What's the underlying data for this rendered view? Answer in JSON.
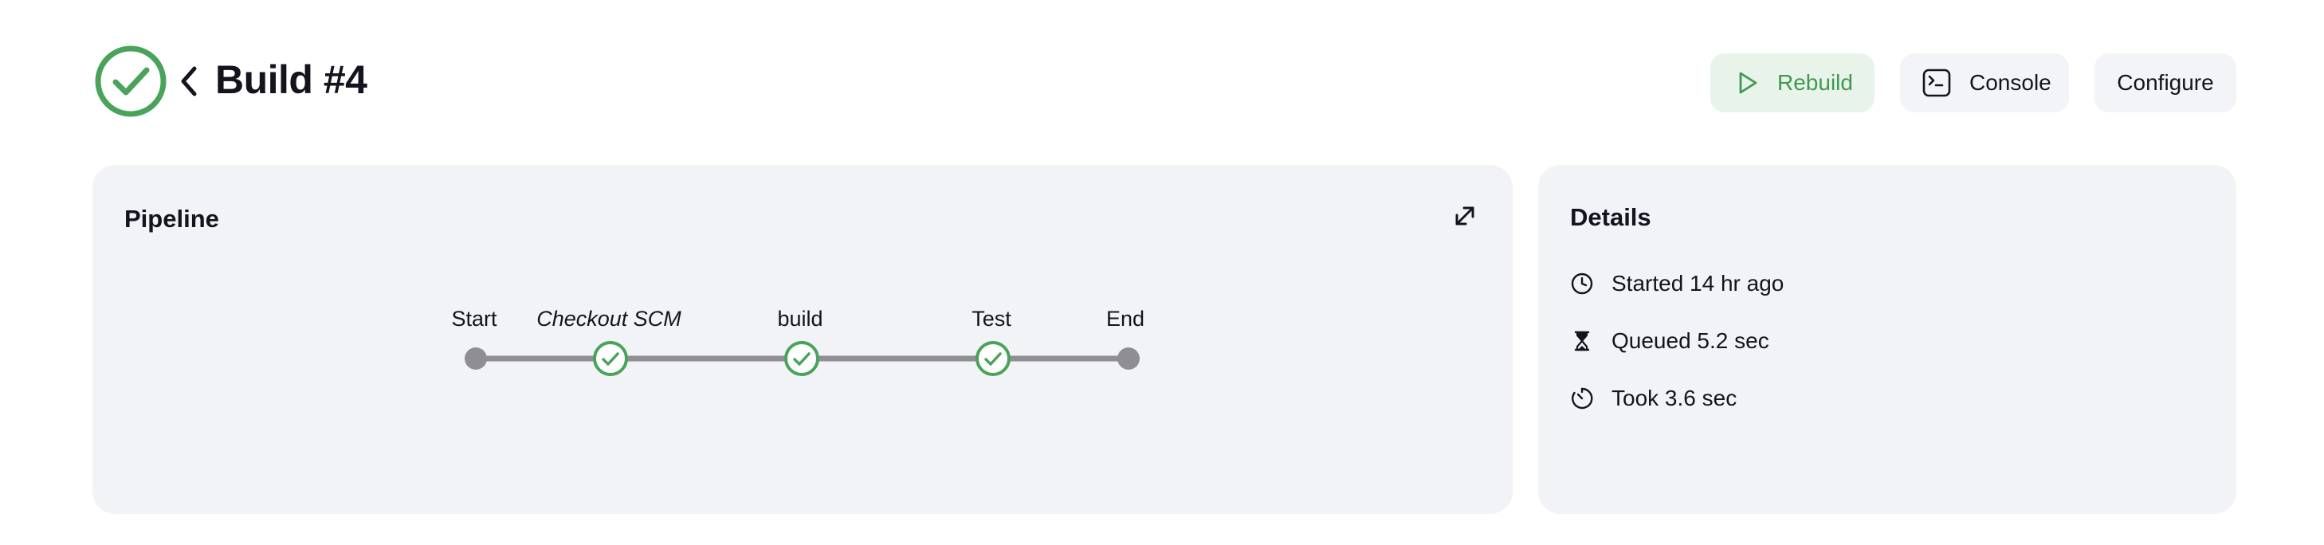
{
  "header": {
    "title": "Build #4",
    "status": "success",
    "rebuild_label": "Rebuild",
    "console_label": "Console",
    "configure_label": "Configure"
  },
  "pipeline": {
    "title": "Pipeline",
    "stages": [
      {
        "label": "Start",
        "kind": "start"
      },
      {
        "label": "Checkout SCM",
        "kind": "stage",
        "status": "success"
      },
      {
        "label": "build",
        "kind": "stage",
        "status": "success"
      },
      {
        "label": "Test",
        "kind": "stage",
        "status": "success"
      },
      {
        "label": "End",
        "kind": "end"
      }
    ]
  },
  "details": {
    "title": "Details",
    "started": "Started 14 hr ago",
    "queued": "Queued 5.2 sec",
    "took": "Took 3.6 sec"
  },
  "colors": {
    "success": "#4aa35a",
    "line": "#8e8e93",
    "card_bg": "#f2f3f6",
    "rebuild_bg": "#e8f3ea"
  },
  "icons": {
    "status": "check-circle-icon",
    "back": "chevron-left-icon",
    "rebuild": "play-icon",
    "console": "terminal-icon",
    "expand": "expand-icon",
    "started": "clock-icon",
    "queued": "hourglass-icon",
    "took": "timer-icon"
  }
}
